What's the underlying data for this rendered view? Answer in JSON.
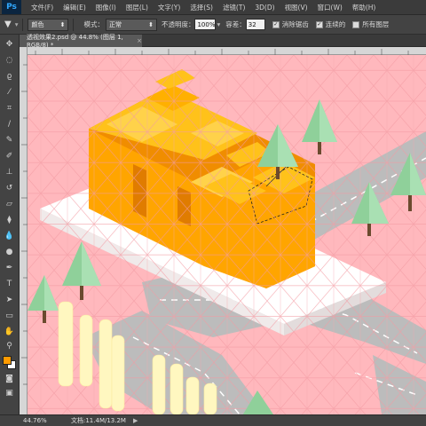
{
  "app": {
    "logo": "Ps"
  },
  "menu": [
    "文件(F)",
    "编辑(E)",
    "图像(I)",
    "图层(L)",
    "文字(Y)",
    "选择(S)",
    "滤镜(T)",
    "3D(D)",
    "视图(V)",
    "窗口(W)",
    "帮助(H)"
  ],
  "options": {
    "preset_label": "颜色",
    "mode_label": "模式：",
    "mode_value": "正常",
    "opacity_label": "不透明度：",
    "opacity_value": "100%",
    "tolerance_label": "容差：",
    "tolerance_value": "32",
    "antialias_label": "消除锯齿",
    "antialias_checked": true,
    "contiguous_label": "连续的",
    "contiguous_checked": true,
    "all_layers_label": "所有图层",
    "all_layers_checked": false
  },
  "document": {
    "tab_title": "透视效果2.psd @ 44.8% (图层 1, RGB/8) *",
    "close_glyph": "×"
  },
  "status": {
    "zoom": "44.76%",
    "doc_info": "文档:11.4M/13.2M",
    "arrow": "▶"
  },
  "colors": {
    "canvas_bg": "#ffb8bd",
    "letters_front": "#ffa500",
    "letters_top": "#ffc21a",
    "letters_side": "#f08d00",
    "tree": "#9bd9a6",
    "trunk": "#6b4a2e",
    "road": "#bcbcbc",
    "platform": "#ffffff",
    "pillar": "#fff7c0",
    "foreground_swatch": "#ff9b00",
    "background_swatch": "#ffffff"
  },
  "icons": [
    "move-icon",
    "marquee-icon",
    "lasso-icon",
    "magic-wand-icon",
    "crop-icon",
    "eyedropper-icon",
    "healing-brush-icon",
    "brush-icon",
    "clone-stamp-icon",
    "history-brush-icon",
    "eraser-icon",
    "paint-bucket-icon",
    "blur-icon",
    "dodge-icon",
    "pen-icon",
    "type-icon",
    "path-selection-icon",
    "rectangle-shape-icon",
    "hand-icon",
    "zoom-icon",
    "quick-mask-icon",
    "screen-mode-icon"
  ]
}
